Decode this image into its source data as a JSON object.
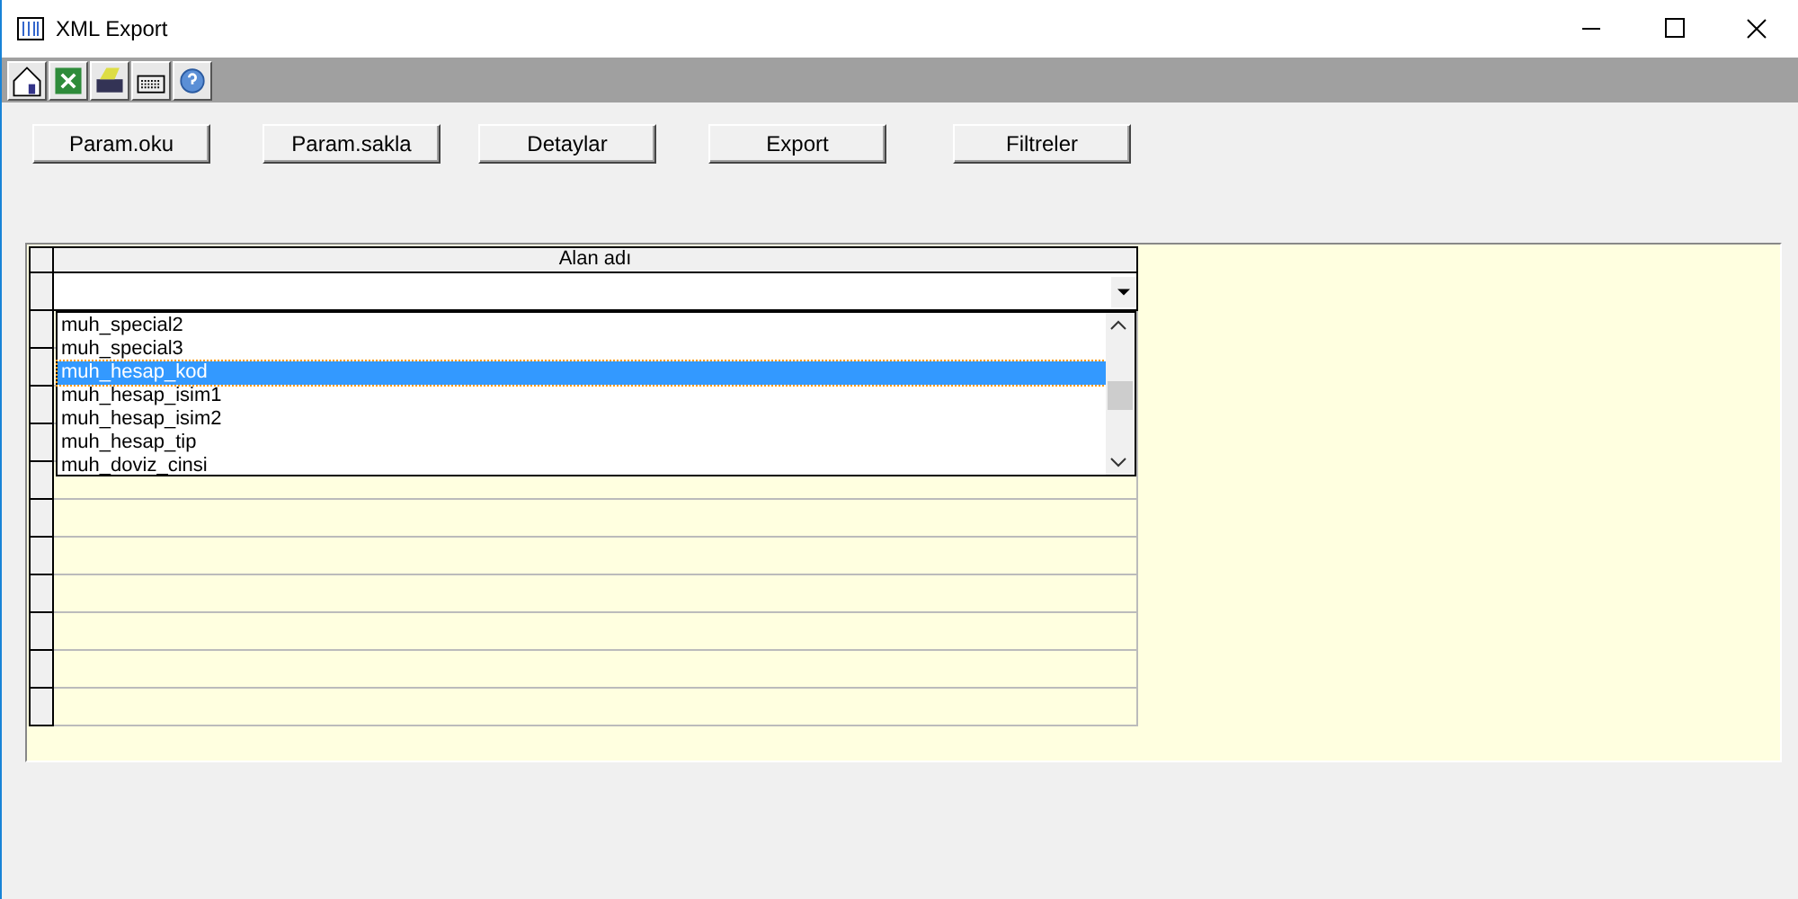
{
  "window": {
    "title": "XML Export"
  },
  "toolbar": [
    {
      "kind": "home"
    },
    {
      "kind": "excel"
    },
    {
      "kind": "printer"
    },
    {
      "kind": "keyboard"
    },
    {
      "kind": "help"
    }
  ],
  "buttons": [
    "Param.oku",
    "Param.sakla",
    "Detaylar",
    "Export",
    "Filtreler"
  ],
  "grid": {
    "columns": [
      "Alan adı"
    ],
    "dropdown": {
      "items": [
        {
          "label": "muh_special2",
          "selected": false
        },
        {
          "label": "muh_special3",
          "selected": false
        },
        {
          "label": "muh_hesap_kod",
          "selected": true
        },
        {
          "label": "muh_hesap_isim1",
          "selected": false
        },
        {
          "label": "muh_hesap_isim2",
          "selected": false
        },
        {
          "label": "muh_hesap_tip",
          "selected": false
        },
        {
          "label": "muh_doviz_cinsi",
          "selected": false
        }
      ]
    }
  }
}
